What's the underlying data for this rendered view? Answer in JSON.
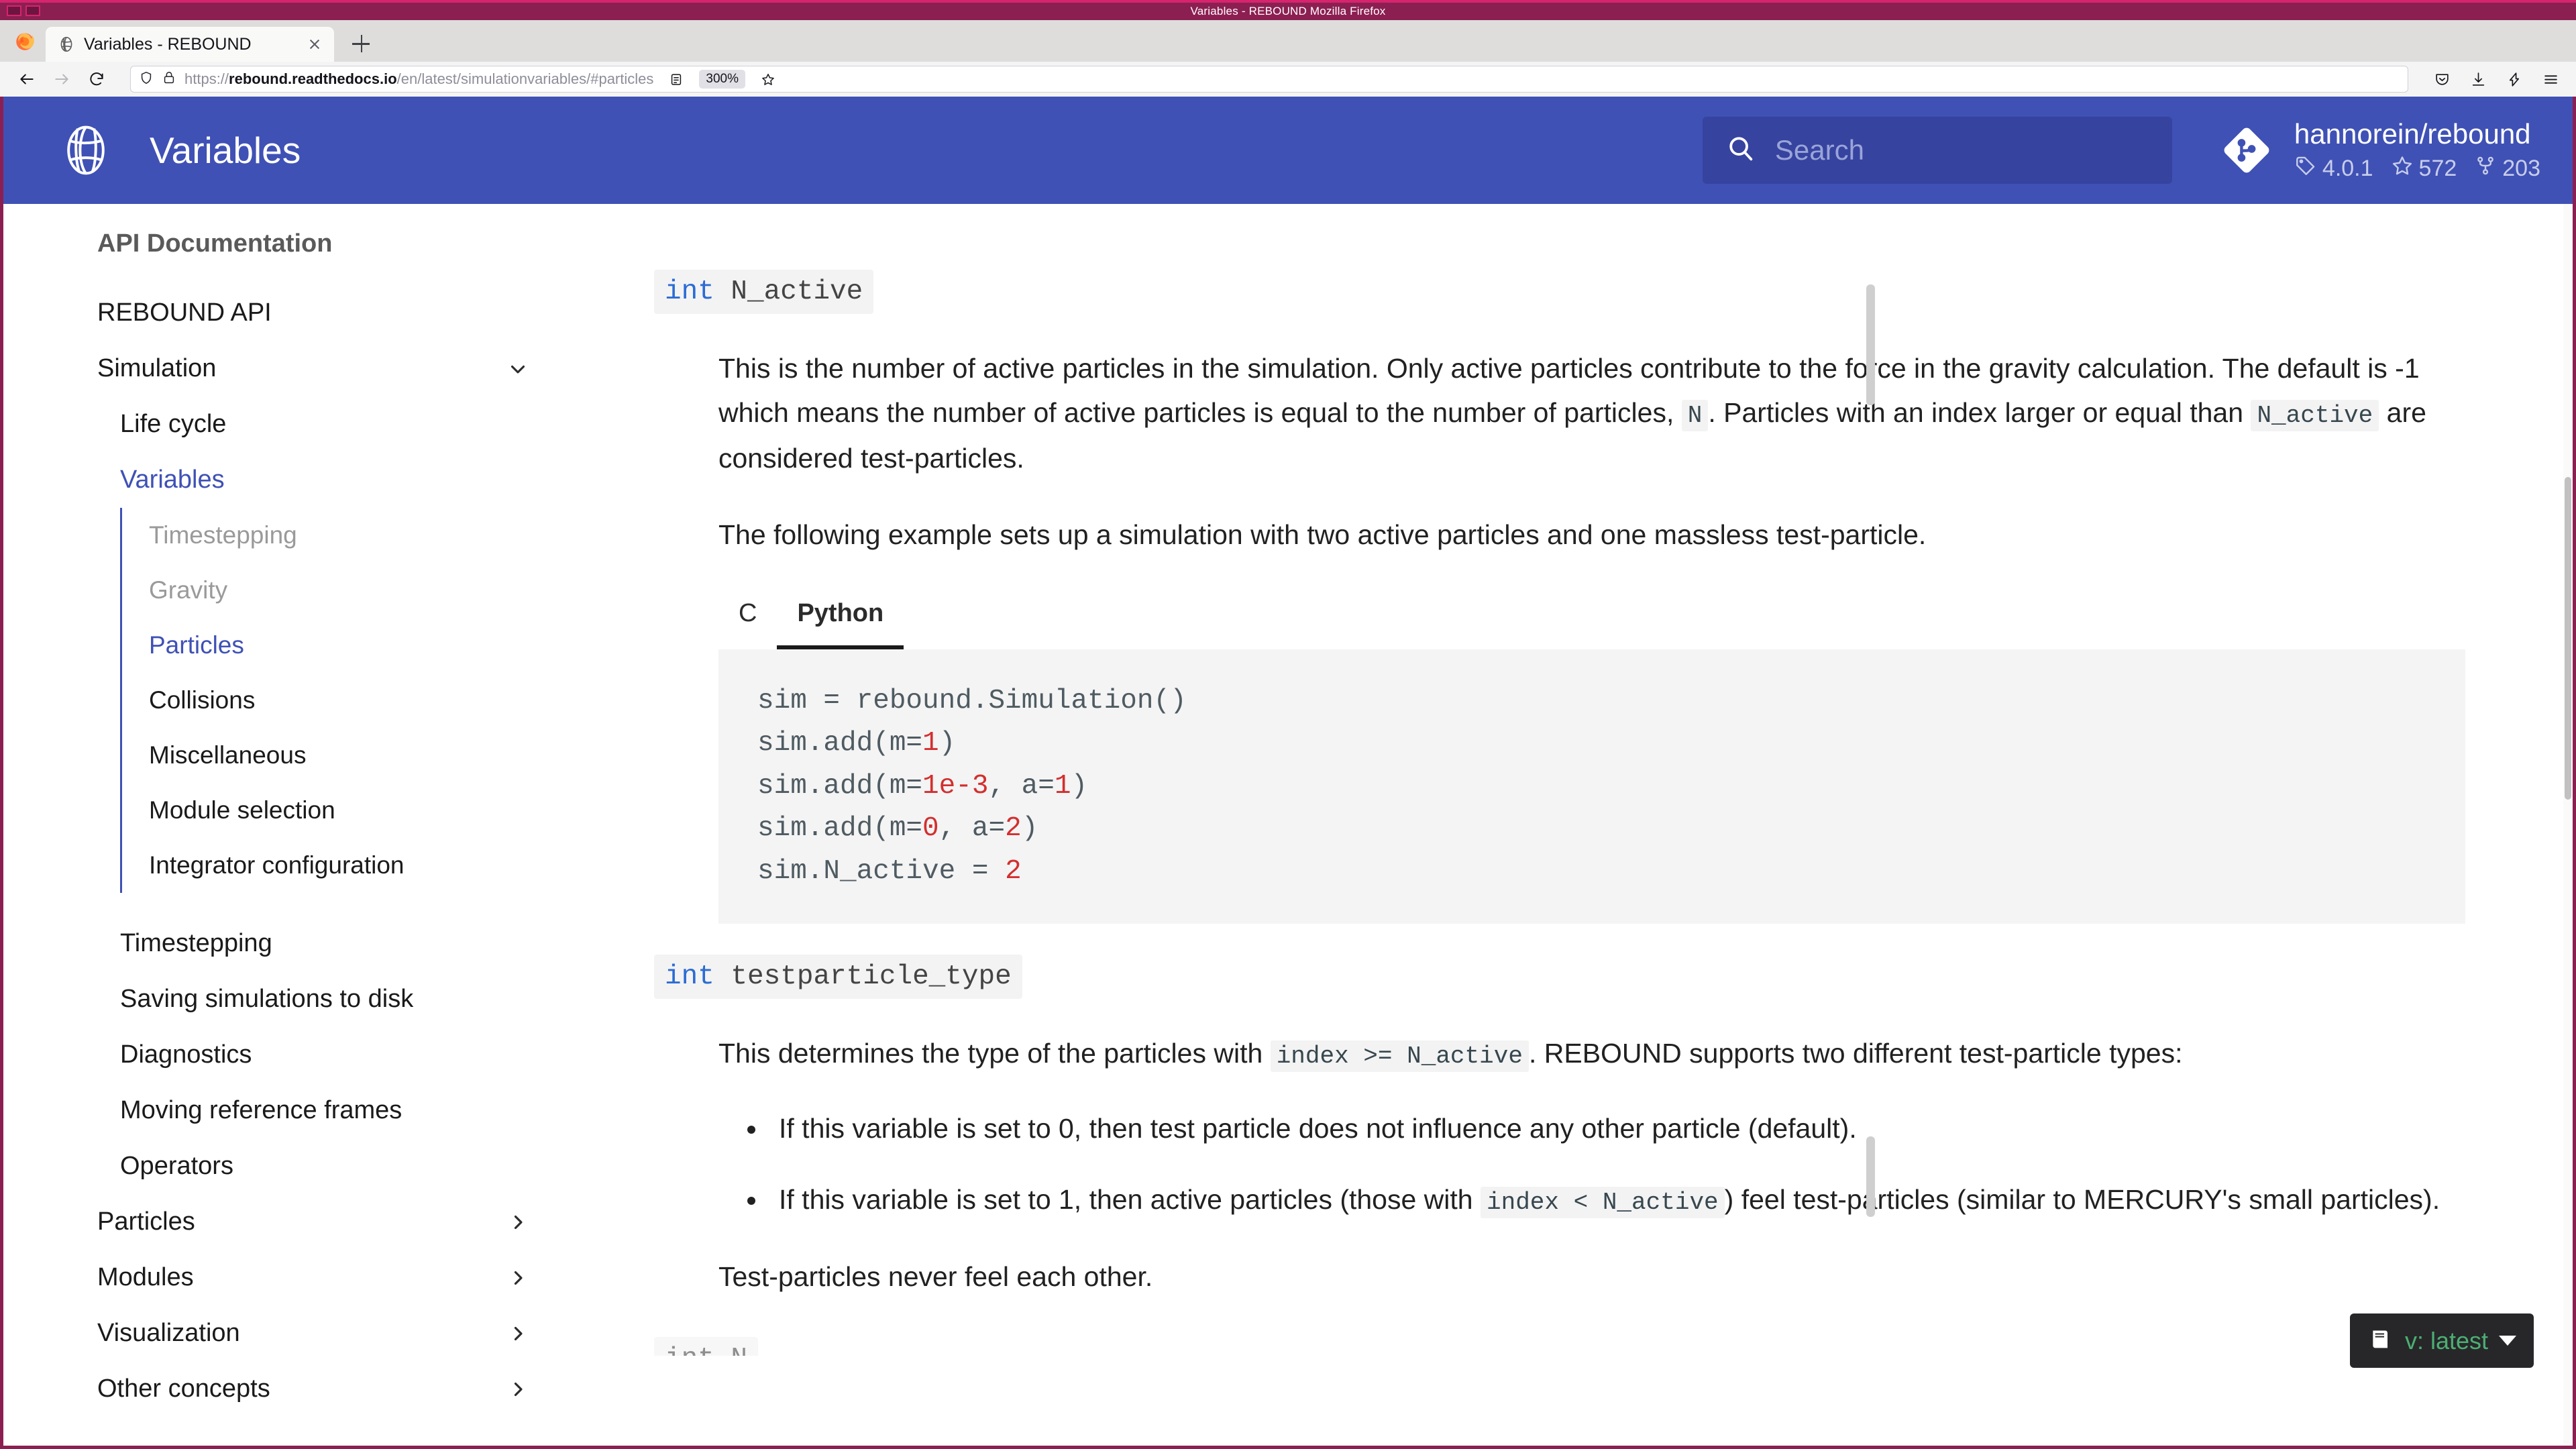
{
  "window": {
    "title": "Variables - REBOUND   Mozilla Firefox"
  },
  "browser": {
    "tab_title": "Variables - REBOUND",
    "tab_favicon_name": "rebound-ball-icon",
    "new_tab_label": "+",
    "url_scheme": "https://",
    "url_host": "rebound.readthedocs.io",
    "url_path": "/en/latest/simulationvariables/#particles",
    "zoom_level": "300%",
    "back_label": "Back",
    "forward_label": "Forward",
    "reload_label": "Reload"
  },
  "site_header": {
    "logo_name": "rebound-ball-logo",
    "title": "Variables",
    "search_placeholder": "Search",
    "search_value": "",
    "repo_name": "hannorein/rebound",
    "repo_version": "4.0.1",
    "repo_stars": "572",
    "repo_forks": "203",
    "background_color": "#3f51b5",
    "search_background": "#36439f"
  },
  "sidebar": {
    "heading": "API Documentation",
    "items": [
      {
        "label": "REBOUND API",
        "level": 0,
        "state": "normal",
        "chevron": ""
      },
      {
        "label": "Simulation",
        "level": 0,
        "state": "normal",
        "chevron": "down"
      },
      {
        "label": "Life cycle",
        "level": 1,
        "state": "normal",
        "chevron": ""
      },
      {
        "label": "Variables",
        "level": 1,
        "state": "active",
        "chevron": ""
      }
    ],
    "sub_items": [
      {
        "label": "Timestepping",
        "state": "muted"
      },
      {
        "label": "Gravity",
        "state": "muted"
      },
      {
        "label": "Particles",
        "state": "active"
      },
      {
        "label": "Collisions",
        "state": "normal"
      },
      {
        "label": "Miscellaneous",
        "state": "normal"
      },
      {
        "label": "Module selection",
        "state": "normal"
      },
      {
        "label": "Integrator configuration",
        "state": "normal"
      }
    ],
    "items_after": [
      {
        "label": "Timestepping",
        "level": 1,
        "state": "normal",
        "chevron": ""
      },
      {
        "label": "Saving simulations to disk",
        "level": 1,
        "state": "normal",
        "chevron": ""
      },
      {
        "label": "Diagnostics",
        "level": 1,
        "state": "normal",
        "chevron": ""
      },
      {
        "label": "Moving reference frames",
        "level": 1,
        "state": "normal",
        "chevron": ""
      },
      {
        "label": "Operators",
        "level": 1,
        "state": "normal",
        "chevron": ""
      },
      {
        "label": "Particles",
        "level": 0,
        "state": "normal",
        "chevron": "right"
      },
      {
        "label": "Modules",
        "level": 0,
        "state": "normal",
        "chevron": "right"
      },
      {
        "label": "Visualization",
        "level": 0,
        "state": "normal",
        "chevron": "right"
      },
      {
        "label": "Other concepts",
        "level": 0,
        "state": "normal",
        "chevron": "right"
      }
    ]
  },
  "content": {
    "section1": {
      "signature_keyword": "int",
      "signature_name": "N_active",
      "paragraph_1a": "This is the number of active particles in the simulation. Only active particles contribute to the force in the gravity calculation. The default is -1 which means the number of active particles is equal to the number of particles,",
      "paragraph_1_code1": "N",
      "paragraph_1b": ". Particles with an index larger or equal than",
      "paragraph_1_code2": "N_active",
      "paragraph_1c": "are considered test-particles.",
      "paragraph_2": "The following example sets up a simulation with two active particles and one massless test-particle."
    },
    "code_tabs": [
      {
        "label": "C",
        "selected": false
      },
      {
        "label": "Python",
        "selected": true
      }
    ],
    "code_lines": [
      {
        "pre": "sim = rebound.Simulation()",
        "parts": []
      },
      {
        "pre": "sim.add(m=",
        "num": "1",
        "post": ")"
      },
      {
        "pre": "sim.add(m=",
        "num": "1e-3",
        "mid": ", a=",
        "num2": "1",
        "post": ")"
      },
      {
        "pre": "sim.add(m=",
        "num": "0",
        "mid": ", a=",
        "num2": "2",
        "post": ")"
      },
      {
        "pre": "sim.N_active = ",
        "num": "2",
        "post": ""
      }
    ],
    "section2": {
      "signature_keyword": "int",
      "signature_name": "testparticle_type",
      "paragraph_1a": "This determines the type of the particles with",
      "paragraph_1_code": "index >= N_active",
      "paragraph_1b": ". REBOUND supports two different test-particle types:",
      "bullets": [
        "If this variable is set to 0, then test particle does not influence any other particle (default).",
        "If this variable is set to 1, then active particles (those with index < N_active) feel test-particles (similar to MERCURY's small particles).",
        "Test-particles never feel each other."
      ],
      "bullet2_pre": "If this variable is set to 1, then active particles (those with",
      "bullet2_code": "index < N_active",
      "bullet2_post": ") feel test-particles (similar to MERCURY's small particles).",
      "closing_paragraph": "Test-particles never feel each other."
    }
  },
  "version_flyout": {
    "icon_name": "book-icon",
    "label": "v: latest",
    "accent_color": "#4caf72",
    "background": "#27272a"
  }
}
